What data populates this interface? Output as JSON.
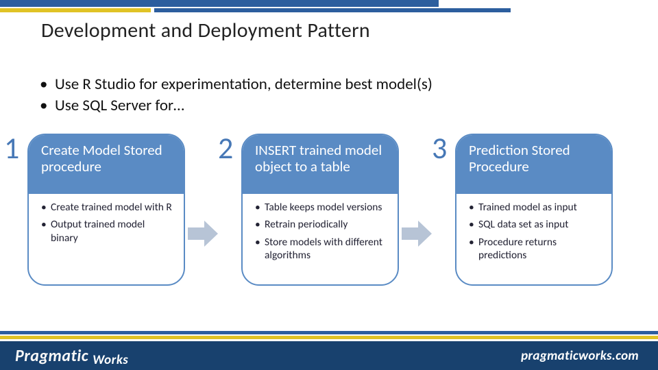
{
  "title": "Development and Deployment Pattern",
  "intro": {
    "items": [
      "Use R Studio for experimentation, determine best model(s)",
      "Use SQL Server for…"
    ]
  },
  "steps": [
    {
      "num": "1",
      "heading": "Create Model Stored procedure",
      "bullets": [
        "Create trained model with R",
        "Output trained model binary"
      ]
    },
    {
      "num": "2",
      "heading": "INSERT trained model object to a table",
      "bullets": [
        "Table keeps model versions",
        "Retrain periodically",
        "Store models with different algorithms"
      ]
    },
    {
      "num": "3",
      "heading": "Prediction Stored Procedure",
      "bullets": [
        "Trained model as input",
        "SQL data set as input",
        "Procedure returns predictions"
      ]
    }
  ],
  "footer": {
    "brand_primary": "Pragmatic",
    "brand_secondary": "Works",
    "url": "pragmaticworks.com"
  },
  "colors": {
    "accent_blue": "#2c5e9e",
    "card_blue": "#5a8bc4",
    "accent_yellow": "#e0c326",
    "footer_navy": "#18416e",
    "arrow_gray": "#b7c4d6"
  }
}
